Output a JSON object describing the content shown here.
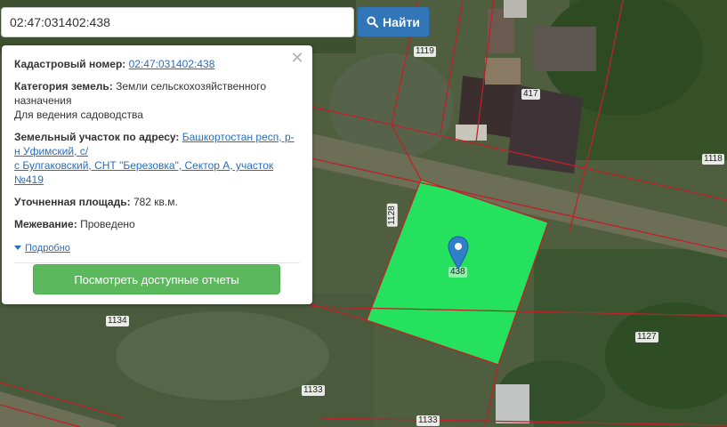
{
  "search": {
    "query": "02:47:031402:438",
    "button_label": "Найти"
  },
  "popup": {
    "cadastral_label": "Кадастровый номер:",
    "cadastral_value": "02:47:031402:438",
    "category_label": "Категория земель:",
    "category_value_line1": "Земли сельскохозяйственного",
    "category_value_line2": "назначения",
    "usage": "Для ведения садоводства",
    "address_label": "Земельный участок по адресу:",
    "address_line1": "Башкортостан респ, р-",
    "address_line2": "н Уфимский, с/",
    "address_line3": "с Булгаковский, СНТ \"Березовка\", Сектор А, участок №419",
    "area_label": "Уточненная площадь:",
    "area_value": "782 кв.м.",
    "survey_label": "Межевание:",
    "survey_value": "Проведено",
    "details_link": "Подробно",
    "reports_button": "Посмотреть доступные отчеты",
    "close_symbol": "✕"
  },
  "map": {
    "parcel_labels": [
      "1119",
      "417",
      "1118",
      "1128",
      "438",
      "1134",
      "1127",
      "1133",
      "1133"
    ],
    "highlight_color": "#22e860",
    "boundary_color": "#c0202a",
    "marker_color": "#2f7fc9"
  },
  "icons": {
    "search": "search-icon",
    "close": "close-icon",
    "marker": "map-marker-icon",
    "caret": "caret-down-icon"
  }
}
